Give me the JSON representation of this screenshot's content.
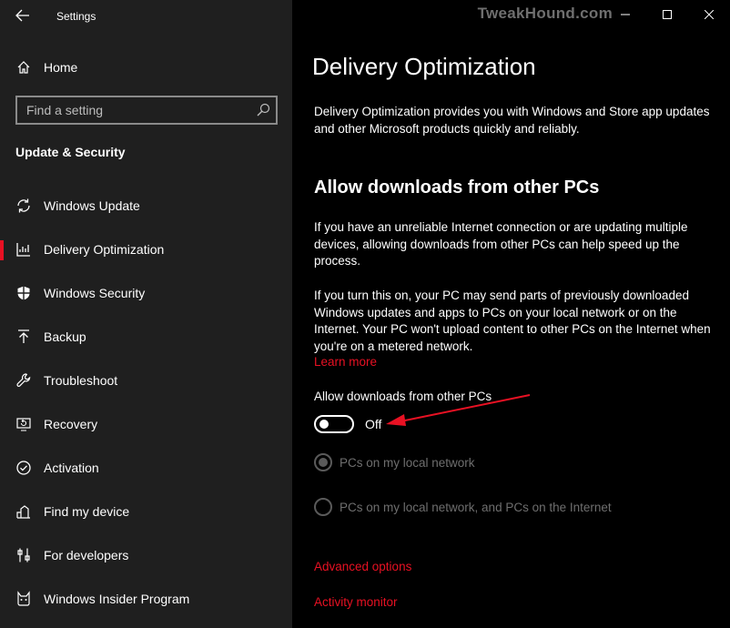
{
  "window": {
    "app_title": "Settings",
    "watermark": "TweakHound.com",
    "back_icon": "back-arrow-icon",
    "controls": [
      "minimize-icon",
      "maximize-icon",
      "close-icon"
    ]
  },
  "sidebar": {
    "home_label": "Home",
    "search_placeholder": "Find a setting",
    "section_heading": "Update & Security",
    "items": [
      {
        "label": "Windows Update",
        "icon": "sync-icon"
      },
      {
        "label": "Delivery Optimization",
        "icon": "delivery-optimization-icon",
        "active": true
      },
      {
        "label": "Windows Security",
        "icon": "shield-icon"
      },
      {
        "label": "Backup",
        "icon": "backup-upload-icon"
      },
      {
        "label": "Troubleshoot",
        "icon": "wrench-icon"
      },
      {
        "label": "Recovery",
        "icon": "recovery-icon"
      },
      {
        "label": "Activation",
        "icon": "check-circle-icon"
      },
      {
        "label": "Find my device",
        "icon": "find-device-icon"
      },
      {
        "label": "For developers",
        "icon": "developer-tools-icon"
      },
      {
        "label": "Windows Insider Program",
        "icon": "insider-cat-icon"
      }
    ]
  },
  "main": {
    "title": "Delivery Optimization",
    "intro": "Delivery Optimization provides you with Windows and Store app updates and other Microsoft products quickly and reliably.",
    "subheading": "Allow downloads from other PCs",
    "para1": "If you have an unreliable Internet connection or are updating multiple devices, allowing downloads from other PCs can help speed up the process.",
    "para2": "If you turn this on, your PC may send parts of previously downloaded Windows updates and apps to PCs on your local network or on the Internet. Your PC won't upload content to other PCs on the Internet when you're on a metered network.",
    "learn_more": "Learn more",
    "toggle_label": "Allow downloads from other PCs",
    "toggle_state": "Off",
    "radio_options": [
      {
        "label": "PCs on my local network",
        "checked": true
      },
      {
        "label": "PCs on my local network, and PCs on the Internet",
        "checked": false
      }
    ],
    "advanced_options": "Advanced options",
    "activity_monitor": "Activity monitor"
  },
  "colors": {
    "accent": "#e81123",
    "sidebar_bg": "#1f1f1f",
    "main_bg": "#000000",
    "disabled_text": "#6e6e6e"
  }
}
